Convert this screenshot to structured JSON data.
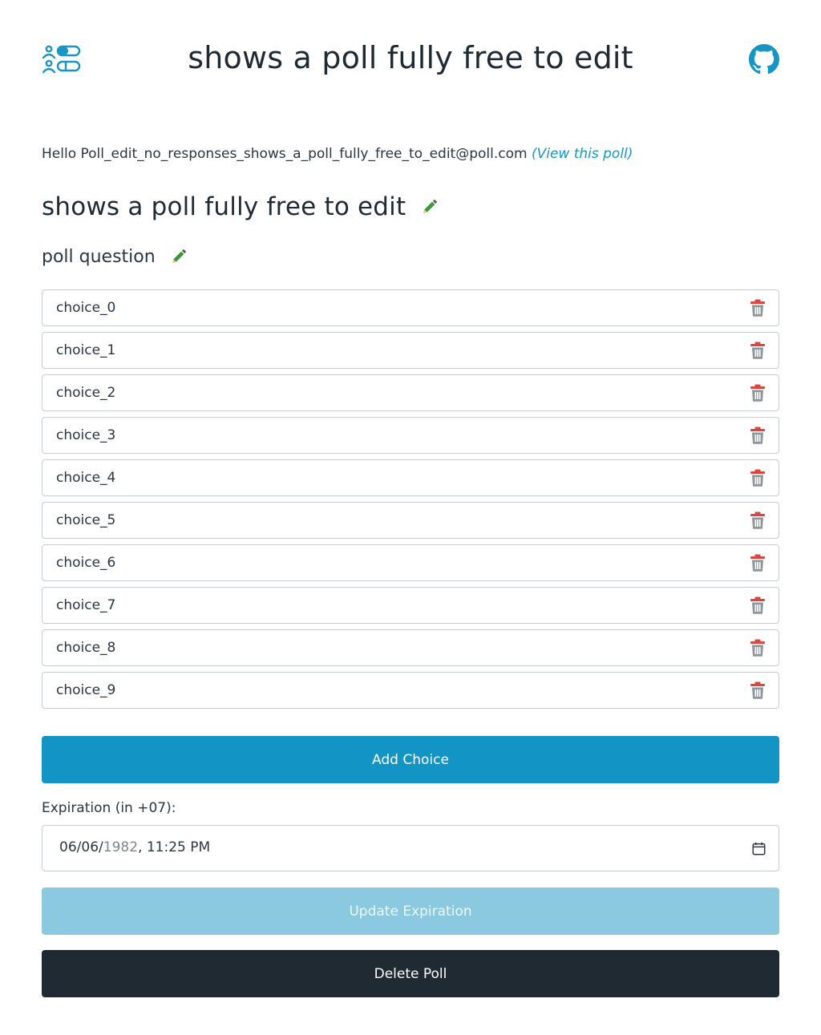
{
  "header": {
    "title": "shows a poll fully free to edit",
    "logo_icon": "poll-app-logo-icon",
    "github_icon": "github-icon"
  },
  "greeting": {
    "prefix": "Hello Poll_edit_no_responses_shows_a_poll_fully_free_to_edit@poll.com",
    "link": "(View this poll)"
  },
  "poll": {
    "title": "shows a poll fully free to edit",
    "question": "poll question",
    "edit_icon": "pencil-icon"
  },
  "choices": [
    {
      "label": "choice_0"
    },
    {
      "label": "choice_1"
    },
    {
      "label": "choice_2"
    },
    {
      "label": "choice_3"
    },
    {
      "label": "choice_4"
    },
    {
      "label": "choice_5"
    },
    {
      "label": "choice_6"
    },
    {
      "label": "choice_7"
    },
    {
      "label": "choice_8"
    },
    {
      "label": "choice_9"
    }
  ],
  "actions": {
    "add_choice": "Add Choice",
    "update_expiration": "Update Expiration",
    "delete_poll": "Delete Poll"
  },
  "expiration": {
    "label": "Expiration (in +07):",
    "month": "06",
    "day": "06",
    "year": "1982",
    "time": "11:25",
    "ampm": "PM",
    "calendar_icon": "calendar-icon"
  },
  "colors": {
    "primary": "#1295c4",
    "primary_disabled": "#8ac9df",
    "dark": "#1f2a33",
    "link": "#1796c6",
    "edit_green": "#3a9a3a",
    "trash_red": "#d9463e",
    "trash_gray": "#8e969b"
  }
}
